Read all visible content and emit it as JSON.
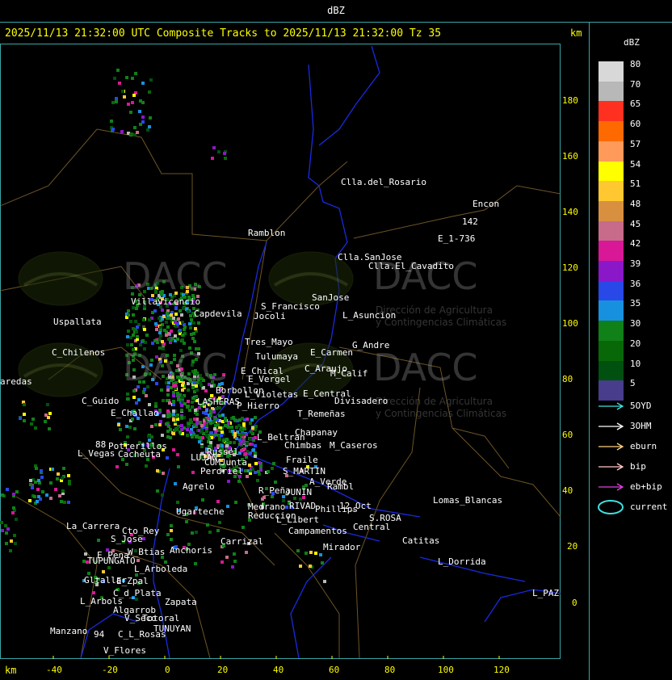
{
  "window_title": "dBZ",
  "header": "2025/11/13 21:32:00 UTC Composite Tracks to 2025/11/13 21:32:00 Tz 35",
  "axis_unit": "km",
  "y_ticks": [
    "180",
    "160",
    "140",
    "120",
    "100",
    "80",
    "60",
    "40",
    "20",
    "0"
  ],
  "x_ticks": [
    "-40",
    "-20",
    "0",
    "20",
    "40",
    "60",
    "80",
    "100",
    "120"
  ],
  "legend": {
    "title": "dBZ",
    "colors": [
      {
        "label": "80",
        "color": "#d8d8d8"
      },
      {
        "label": "70",
        "color": "#b8b8b8"
      },
      {
        "label": "65",
        "color": "#ff3020"
      },
      {
        "label": "60",
        "color": "#ff6a00"
      },
      {
        "label": "57",
        "color": "#ff9a5a"
      },
      {
        "label": "54",
        "color": "#ffff00"
      },
      {
        "label": "51",
        "color": "#ffc830"
      },
      {
        "label": "48",
        "color": "#d89040"
      },
      {
        "label": "45",
        "color": "#c86a8a"
      },
      {
        "label": "42",
        "color": "#d81896"
      },
      {
        "label": "39",
        "color": "#8a18c8"
      },
      {
        "label": "36",
        "color": "#2848e8"
      },
      {
        "label": "35",
        "color": "#1890e0"
      },
      {
        "label": "30",
        "color": "#108018"
      },
      {
        "label": "20",
        "color": "#086808"
      },
      {
        "label": "10",
        "color": "#005010"
      },
      {
        "label": "5",
        "color": "#483c8c"
      }
    ],
    "tracks": [
      {
        "label": "5OYD",
        "color": "#40e0e0"
      },
      {
        "label": "3OHM",
        "color": "#ffffff"
      },
      {
        "label": "eburn",
        "color": "#ffd080"
      },
      {
        "label": "bip",
        "color": "#ffc8c8"
      },
      {
        "label": "eb+bip",
        "color": "#e040e0"
      },
      {
        "label": "current",
        "color": "#40e0e0"
      }
    ]
  },
  "watermark": {
    "brand": "DACC",
    "line1": "Dirección de Agricultura",
    "line2": "y Contingencias Climáticas"
  },
  "towns": [
    {
      "name": "Clla.del_Rosario"
    },
    {
      "name": "Encon"
    },
    {
      "name": "142"
    },
    {
      "name": "E_1-736"
    },
    {
      "name": "Ramblon"
    },
    {
      "name": "Clla.SanJose"
    },
    {
      "name": "Clla.El_Cavadito"
    },
    {
      "name": "Villavicencio"
    },
    {
      "name": "S_Francisco"
    },
    {
      "name": "SanJose"
    },
    {
      "name": "Uspallata"
    },
    {
      "name": "Capdevila"
    },
    {
      "name": "Jocoli"
    },
    {
      "name": "L_Asuncion"
    },
    {
      "name": "Tres_Mayo"
    },
    {
      "name": "G_Andre"
    },
    {
      "name": "C_Chilenos"
    },
    {
      "name": "Tulumaya"
    },
    {
      "name": "E_Carmen"
    },
    {
      "name": "E_Chical"
    },
    {
      "name": "C_Araujo"
    },
    {
      "name": "M_Calif"
    },
    {
      "name": "E_Vergel"
    },
    {
      "name": "aredas"
    },
    {
      "name": "Borbollon"
    },
    {
      "name": "L_Violetas"
    },
    {
      "name": "E_Central"
    },
    {
      "name": "C_Guido"
    },
    {
      "name": "LASHERAS"
    },
    {
      "name": "P_Hierro"
    },
    {
      "name": "Divisadero"
    },
    {
      "name": "E_Challao"
    },
    {
      "name": "T_Remeñas"
    },
    {
      "name": "Chapanay"
    },
    {
      "name": "L_Beltran"
    },
    {
      "name": "Chimbas"
    },
    {
      "name": "M_Caseros"
    },
    {
      "name": "88"
    },
    {
      "name": "Potrerillos"
    },
    {
      "name": "L_Vegas"
    },
    {
      "name": "Cacheuta"
    },
    {
      "name": "LUJAN"
    },
    {
      "name": "Russel"
    },
    {
      "name": "CUMJunta"
    },
    {
      "name": "Fraile"
    },
    {
      "name": "S_MARTIN"
    },
    {
      "name": "Perdriel"
    },
    {
      "name": "A_Verde"
    },
    {
      "name": "Rambl"
    },
    {
      "name": "Agrelo"
    },
    {
      "name": "R_Peña"
    },
    {
      "name": "JUNIN"
    },
    {
      "name": "12_Oct"
    },
    {
      "name": "Ugarteche"
    },
    {
      "name": "Medrano"
    },
    {
      "name": "RIVAD"
    },
    {
      "name": "Phillips"
    },
    {
      "name": "Reduccion"
    },
    {
      "name": "S.ROSA"
    },
    {
      "name": "Lomas_Blancas"
    },
    {
      "name": "La_Carrera"
    },
    {
      "name": "Cto_Rey"
    },
    {
      "name": "L_Libert"
    },
    {
      "name": "Central"
    },
    {
      "name": "S_Jose"
    },
    {
      "name": "Campamentos"
    },
    {
      "name": "Catitas"
    },
    {
      "name": "Carrizal"
    },
    {
      "name": "W_Btias"
    },
    {
      "name": "Anchoris"
    },
    {
      "name": "E_Pena"
    },
    {
      "name": "TUPUNGATO"
    },
    {
      "name": "Mirador"
    },
    {
      "name": "L_Dorrida"
    },
    {
      "name": "L_Arboleda"
    },
    {
      "name": "Gltallar"
    },
    {
      "name": "E_Zpal"
    },
    {
      "name": "L_PAZ"
    },
    {
      "name": "C_d_Plata"
    },
    {
      "name": "L_Arbols"
    },
    {
      "name": "Zapata"
    },
    {
      "name": "Algarrob"
    },
    {
      "name": "V_Seco"
    },
    {
      "name": "Totoral"
    },
    {
      "name": "TUNUYAN"
    },
    {
      "name": "Manzano"
    },
    {
      "name": "94"
    },
    {
      "name": "C_L_Rosas"
    },
    {
      "name": "V_Flores"
    }
  ]
}
